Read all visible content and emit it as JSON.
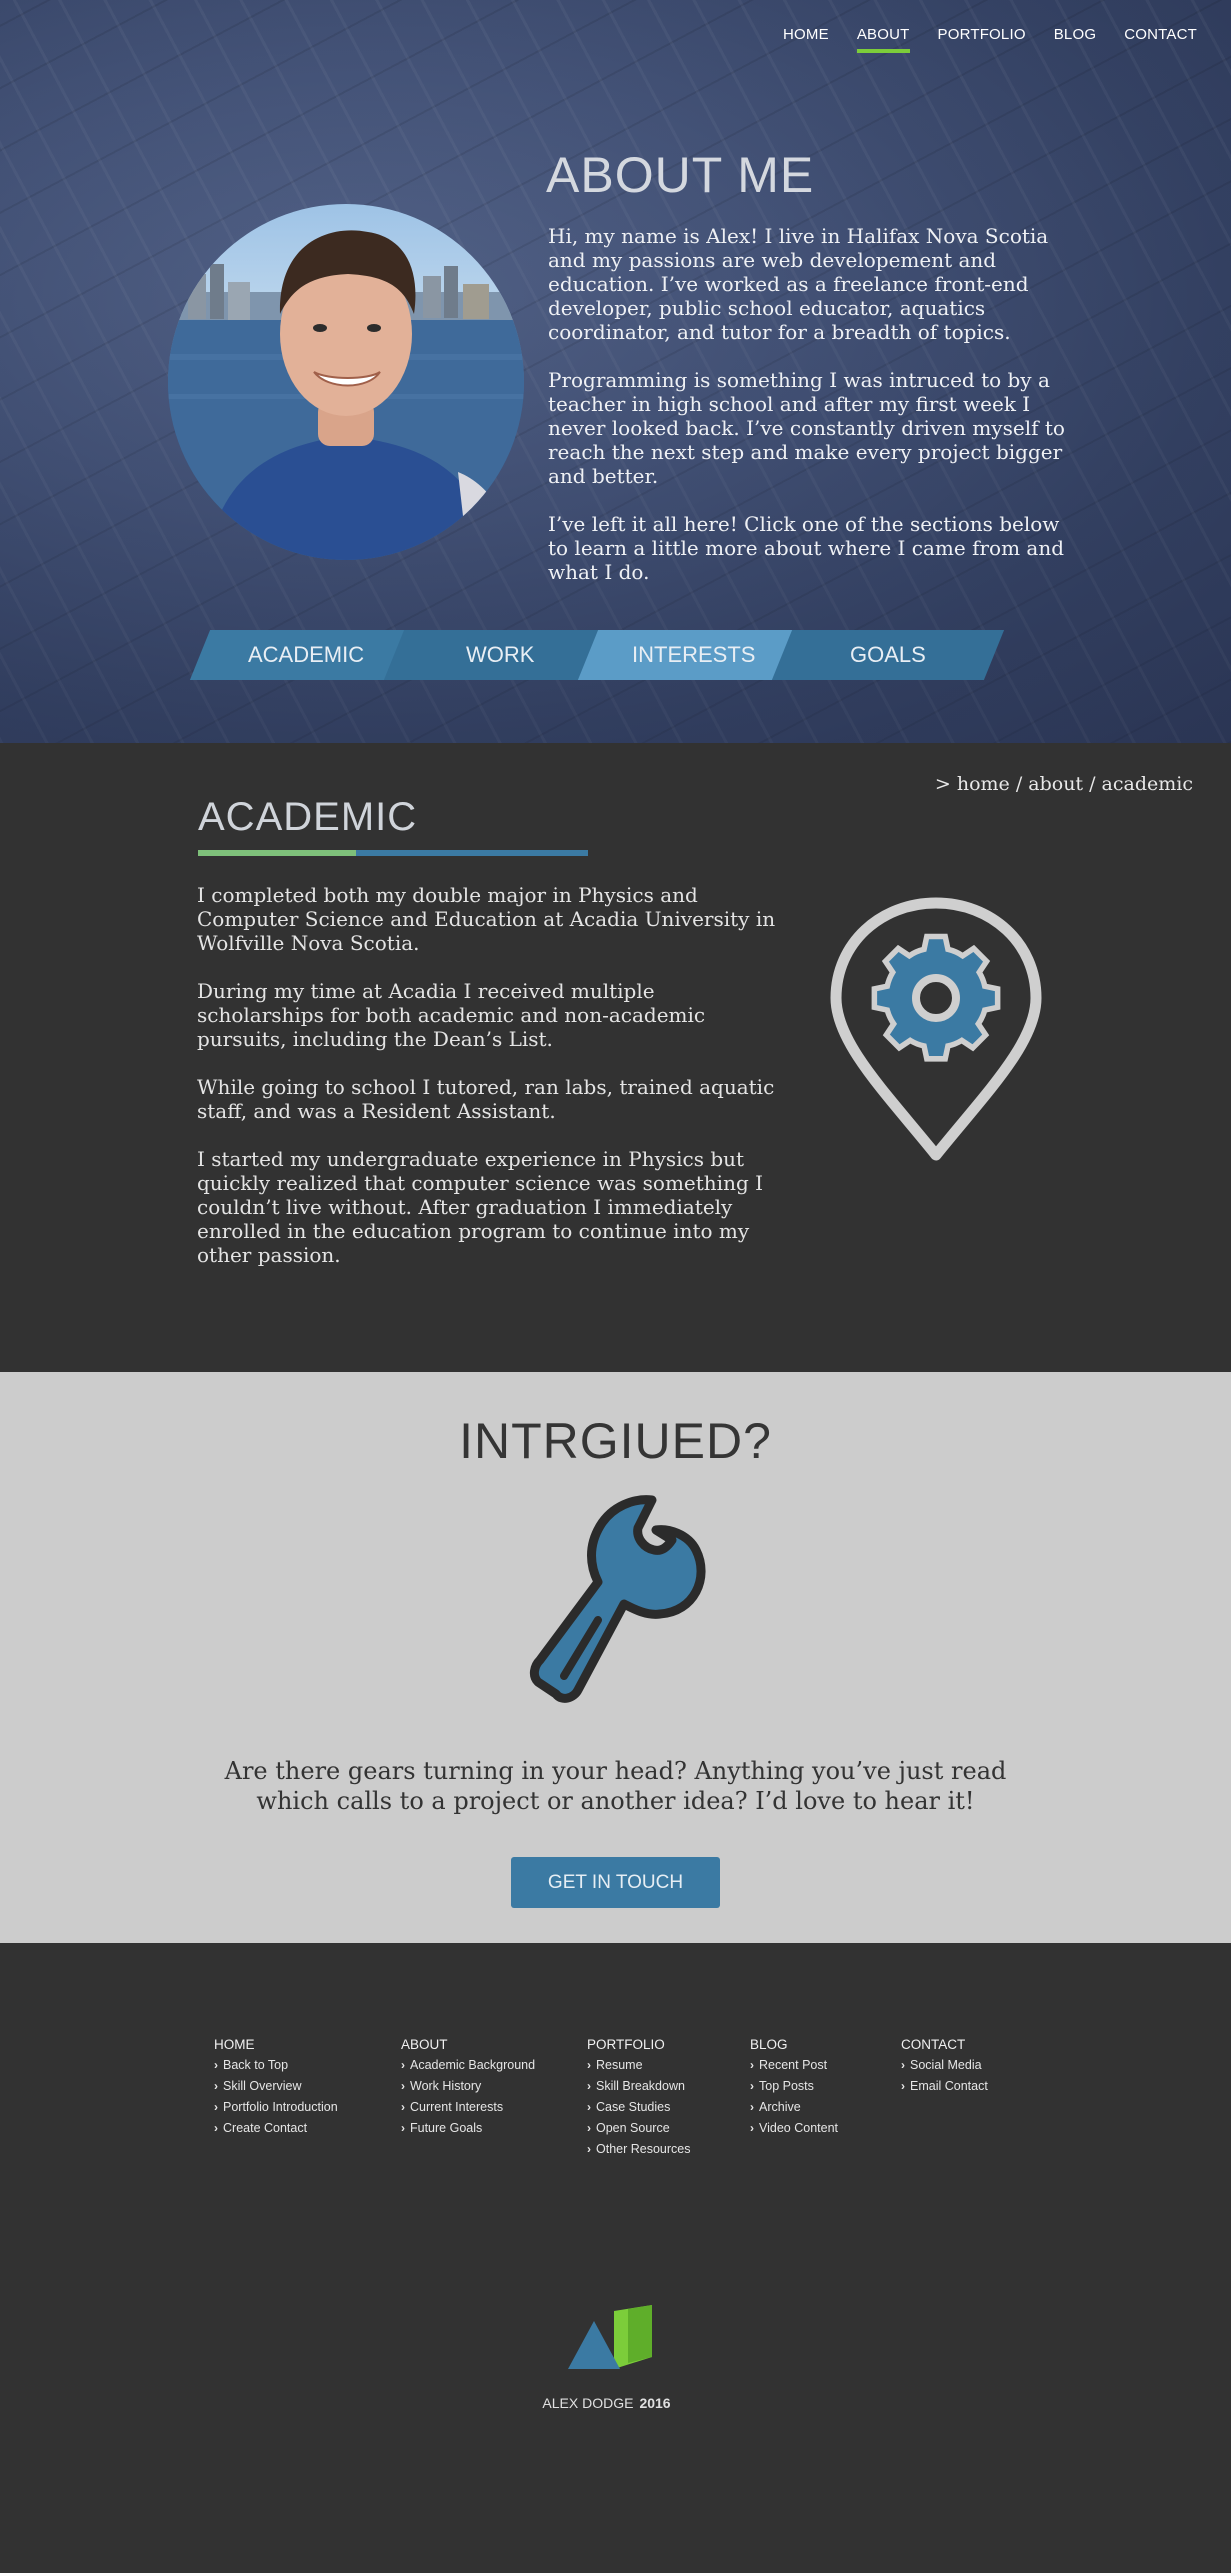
{
  "nav": {
    "items": [
      "HOME",
      "ABOUT",
      "PORTFOLIO",
      "BLOG",
      "CONTACT"
    ],
    "active": "ABOUT"
  },
  "hero": {
    "title": "ABOUT ME",
    "paragraphs": [
      "Hi, my name is Alex! I live in Halifax Nova Scotia and my passions are web developement and education. I’ve worked as a freelance front-end developer, public school educator, aquatics coordinator, and tutor for a breadth of topics.",
      "Programming is something I was intruced to by a teacher in high school and after my first week I never looked back. I’ve constantly driven myself to reach the next step and make every project bigger and better.",
      "I’ve left it all here! Click one of the sections below to learn a little more about where I came from and what I do."
    ],
    "tabs": [
      "ACADEMIC",
      "WORK",
      "INTERESTS",
      "GOALS"
    ]
  },
  "academic": {
    "breadcrumb": "> home / about /  academic",
    "title": "ACADEMIC",
    "paragraphs": [
      "I completed both my double major in Physics and Computer Science and Education at Acadia University in Wolfville Nova Scotia.",
      "During my time at Acadia I received multiple scholarships for both academic and non-academic pursuits, including the Dean’s List.",
      "While going to school I tutored, ran labs, trained aquatic staff, and was a Resident Assistant.",
      "I started my undergraduate experience in Physics but quickly realized that computer science was something I couldn’t live without. After graduation I immediately enrolled in the education program to continue into my other passion."
    ],
    "icon": "location-gear-icon"
  },
  "intrigued": {
    "title": "INTRGIUED?",
    "text_line1": "Are there gears turning in your head? Anything you’ve just read",
    "text_line2": "which calls to a project or another idea? I’d love to hear it!",
    "button": "GET IN TOUCH",
    "icon": "wrench-icon"
  },
  "footer": {
    "columns": [
      {
        "heading": "HOME",
        "items": [
          "Back to Top",
          "Skill Overview",
          "Portfolio Introduction",
          "Create Contact"
        ]
      },
      {
        "heading": "ABOUT",
        "items": [
          "Academic Background",
          "Work History",
          "Current Interests",
          "Future Goals"
        ]
      },
      {
        "heading": "PORTFOLIO",
        "items": [
          "Resume",
          "Skill Breakdown",
          "Case Studies",
          "Open Source",
          "Other Resources"
        ]
      },
      {
        "heading": "BLOG",
        "items": [
          "Recent Post",
          "Top Posts",
          "Archive",
          "Video Content"
        ]
      },
      {
        "heading": "CONTACT",
        "items": [
          "Social Media",
          "Email Contact"
        ]
      }
    ],
    "name": "ALEX DODGE",
    "year": "2016"
  },
  "colors": {
    "accent_blue": "#3b7aa3",
    "accent_green": "#7ccd3a",
    "dark_bg": "#323232",
    "light_bg": "#cccccc"
  }
}
